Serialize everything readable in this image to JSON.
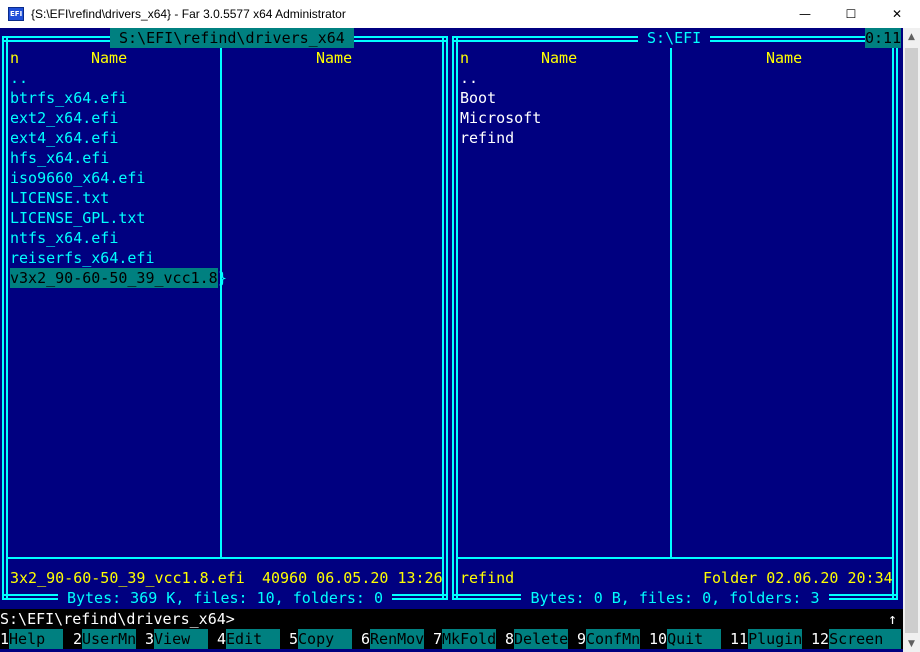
{
  "window": {
    "title": "{S:\\EFI\\refind\\drivers_x64} - Far 3.0.5577 x64 Administrator",
    "icon_label": "EFI",
    "minimize": "—",
    "maximize": "☐",
    "close": "✕"
  },
  "left_panel": {
    "path": " S:\\EFI\\refind\\drivers_x64 ",
    "col_n": "n",
    "col_name_1": "Name",
    "col_name_2": "Name",
    "items": [
      "..",
      "btrfs_x64.efi",
      "ext2_x64.efi",
      "ext4_x64.efi",
      "hfs_x64.efi",
      "iso9660_x64.efi",
      "LICENSE.txt",
      "LICENSE_GPL.txt",
      "ntfs_x64.efi",
      "reiserfs_x64.efi",
      "v3x2_90-60-50_39_vcc1.8"
    ],
    "overflow_marker": "}",
    "status_name": "3x2_90-60-50_39_vcc1.8.efi",
    "status_info": "40960 06.05.20 13:26",
    "totals": " Bytes: 369 K, files: 10, folders: 0 "
  },
  "right_panel": {
    "path": " S:\\EFI ",
    "clock": "0:11",
    "col_n": "n",
    "col_name_1": "Name",
    "col_name_2": "Name",
    "items": [
      "..",
      "Boot",
      "Microsoft",
      "refind"
    ],
    "status_name": "refind",
    "status_info": "Folder 02.06.20 20:34",
    "totals": " Bytes: 0 B, files: 0, folders: 3 "
  },
  "command_line": {
    "prompt": "S:\\EFI\\refind\\drivers_x64>",
    "indicator": "↑"
  },
  "keybar": [
    {
      "num": "1",
      "label": "Help  "
    },
    {
      "num": "2",
      "label": "UserMn"
    },
    {
      "num": "3",
      "label": "View  "
    },
    {
      "num": "4",
      "label": "Edit  "
    },
    {
      "num": "5",
      "label": "Copy  "
    },
    {
      "num": "6",
      "label": "RenMov"
    },
    {
      "num": "7",
      "label": "MkFold"
    },
    {
      "num": "8",
      "label": "Delete"
    },
    {
      "num": "9",
      "label": "ConfMn"
    },
    {
      "num": "10",
      "label": "Quit  "
    },
    {
      "num": "11",
      "label": "Plugin"
    },
    {
      "num": "12",
      "label": "Screen"
    }
  ],
  "colors": {
    "panel_bg": "#000080",
    "frame": "#00ffff",
    "file_text": "#00ffff",
    "header_text": "#ffff00",
    "highlight": "#008080"
  }
}
